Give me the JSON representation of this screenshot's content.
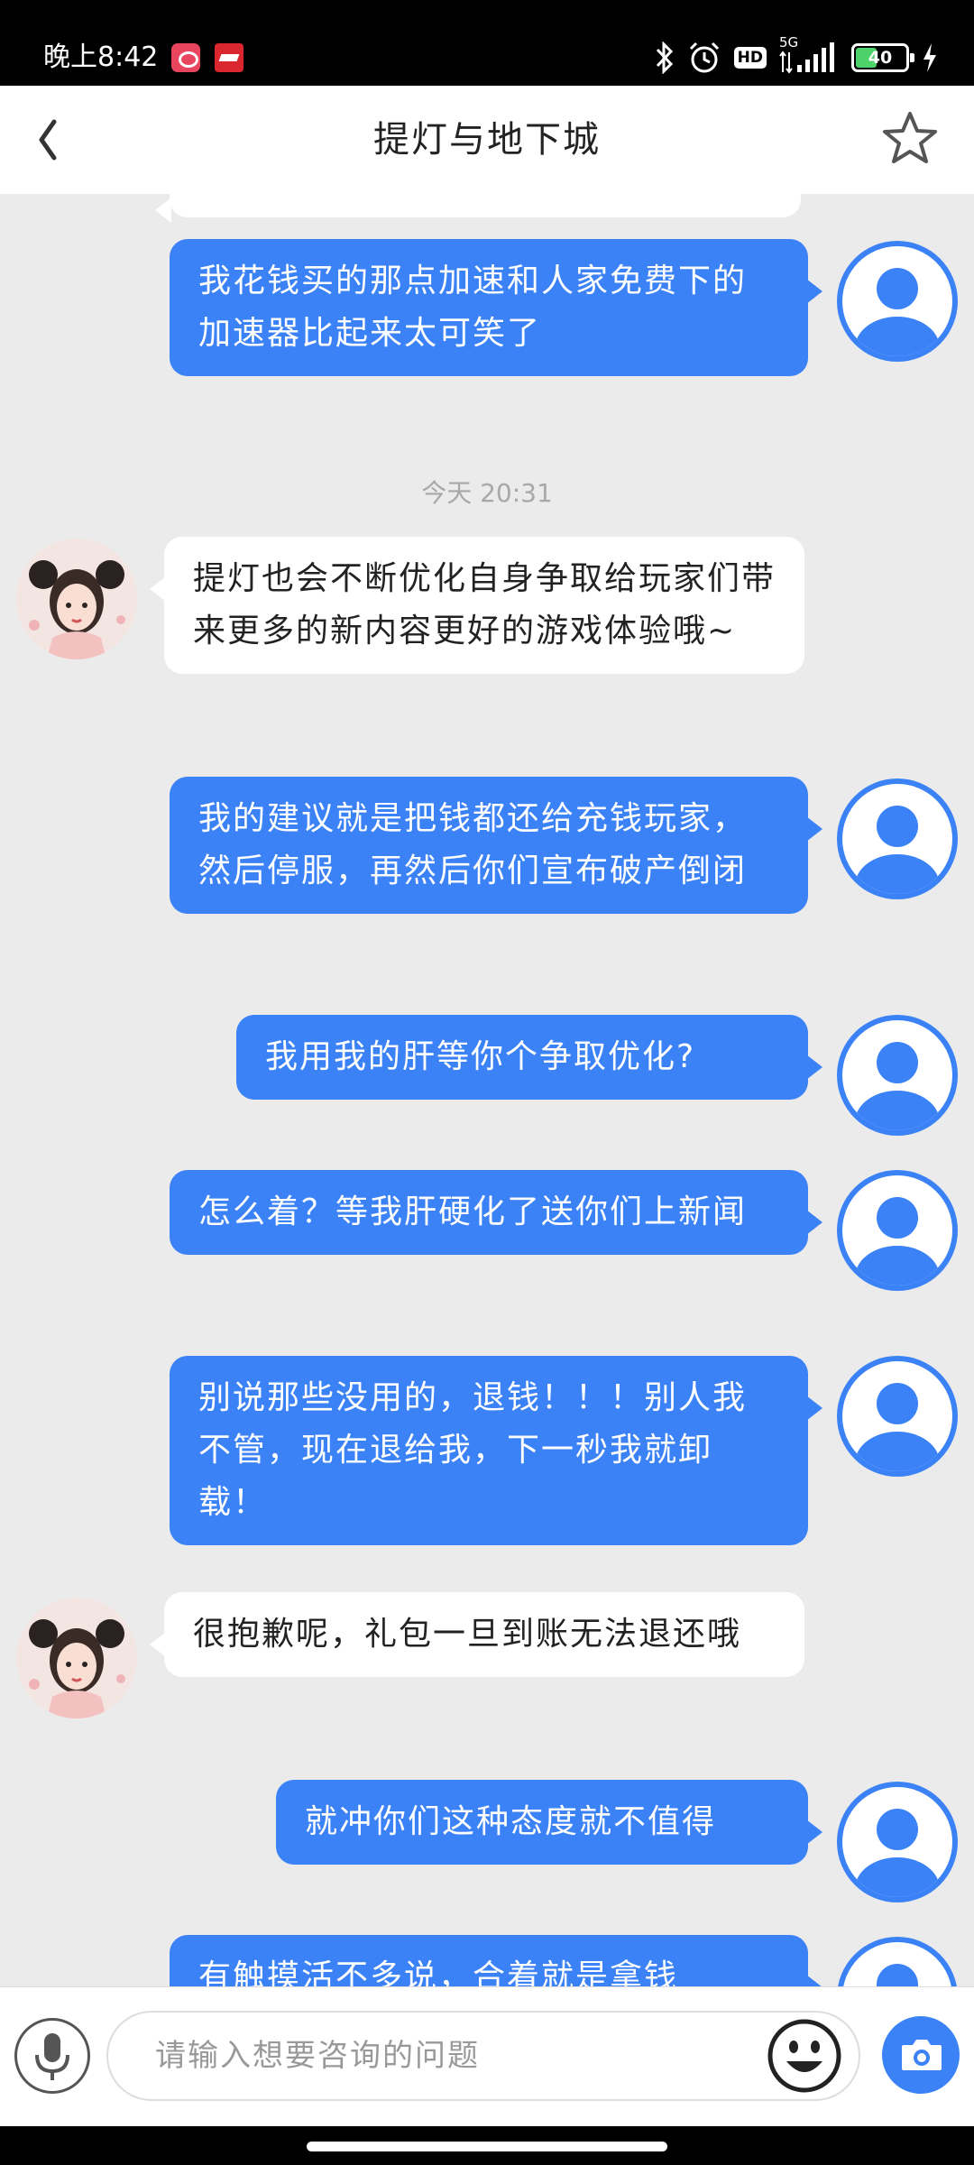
{
  "status_bar": {
    "time": "晚上8:42",
    "network": "5G",
    "hd": "HD",
    "battery": "40"
  },
  "nav": {
    "title": "提灯与地下城"
  },
  "chat": {
    "timestamp": "今天 20:31",
    "messages": [
      {
        "from": "user",
        "text": "我花钱买的那点加速和人家免费下的加速器比起来太可笑了"
      },
      {
        "from": "agent",
        "text": "提灯也会不断优化自身争取给玩家们带来更多的新内容更好的游戏体验哦~"
      },
      {
        "from": "user",
        "text": "我的建议就是把钱都还给充钱玩家，然后停服，再然后你们宣布破产倒闭"
      },
      {
        "from": "user",
        "text": "我用我的肝等你个争取优化?"
      },
      {
        "from": "user",
        "text": "怎么着？等我肝硬化了送你们上新闻"
      },
      {
        "from": "user",
        "text": "别说那些没用的，退钱！！！别人我不管，现在退给我，下一秒我就卸载！"
      },
      {
        "from": "agent",
        "text": "很抱歉呢，礼包一旦到账无法退还哦"
      },
      {
        "from": "user",
        "text": "就冲你们这种态度就不值得"
      },
      {
        "from": "user",
        "text": "有触摸活不多说，合着就是拿钱"
      }
    ]
  },
  "input": {
    "placeholder": "请输入想要咨询的问题"
  },
  "icons": {
    "back": "chevron-left-icon",
    "favorite": "star-icon",
    "mic": "microphone-icon",
    "emoji": "smiley-icon",
    "camera": "camera-icon"
  },
  "colors": {
    "accent": "#3b82f7",
    "chat_bg": "#ebebeb"
  }
}
